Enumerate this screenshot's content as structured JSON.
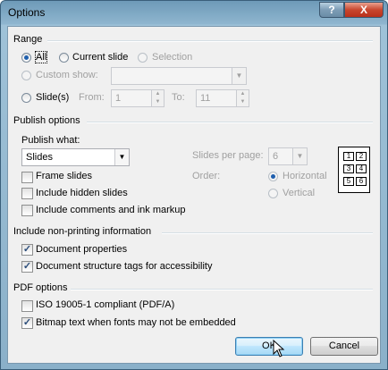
{
  "window": {
    "title": "Options",
    "help_glyph": "?",
    "close_glyph": "X"
  },
  "range": {
    "header": "Range",
    "all": "All",
    "current_slide": "Current slide",
    "selection": "Selection",
    "custom_show": "Custom show:",
    "slides": "Slide(s)",
    "from_label": "From:",
    "from_value": "1",
    "to_label": "To:",
    "to_value": "11"
  },
  "publish": {
    "header": "Publish options",
    "what_label": "Publish what:",
    "what_value": "Slides",
    "slides_per_page_label": "Slides per page:",
    "slides_per_page_value": "6",
    "order_label": "Order:",
    "horizontal": "Horizontal",
    "vertical": "Vertical",
    "frame_slides": "Frame slides",
    "include_hidden": "Include hidden slides",
    "include_comments": "Include comments and ink markup",
    "page_preview": [
      "1",
      "2",
      "3",
      "4",
      "5",
      "6"
    ]
  },
  "nonprinting": {
    "header": "Include non-printing information",
    "doc_props": "Document properties",
    "doc_structure": "Document structure tags for accessibility"
  },
  "pdf": {
    "header": "PDF options",
    "iso": "ISO 19005-1 compliant (PDF/A)",
    "bitmap": "Bitmap text when fonts may not be embedded"
  },
  "buttons": {
    "ok": "OK",
    "cancel": "Cancel"
  },
  "colors": {
    "title_bar": "#7fa8c4",
    "close_button": "#c8462e",
    "client_bg": "#f0f0f0",
    "checkmark": "#2b4d7a"
  }
}
